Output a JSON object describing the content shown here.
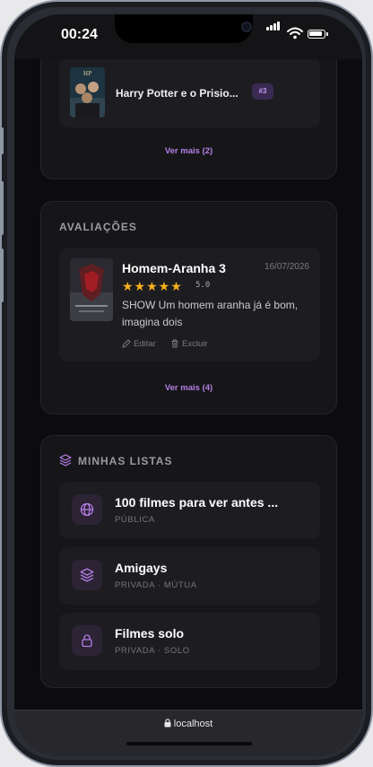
{
  "status": {
    "time": "00:24"
  },
  "top_list": {
    "item_title": "Harry Potter e o Prisio...",
    "rank_badge": "#3",
    "see_more": "Ver mais (2)"
  },
  "reviews": {
    "section_title": "AVALIAÇÕES",
    "items": [
      {
        "title": "Homem-Aranha 3",
        "date": "16/07/2026",
        "stars": "★★★★★",
        "score": "5.0",
        "text": "SHOW Um homem aranha já é bom, imagina dois",
        "edit_label": "Editar",
        "delete_label": "Excluir"
      }
    ],
    "see_more": "Ver mais (4)"
  },
  "lists": {
    "section_title": "MINHAS LISTAS",
    "items": [
      {
        "name": "100 filmes para ver antes ...",
        "meta": "PÚBLICA",
        "icon": "globe-icon"
      },
      {
        "name": "Amigays",
        "meta": "PRIVADA · MÚTUA",
        "icon": "layers-icon"
      },
      {
        "name": "Filmes solo",
        "meta": "PRIVADA · SOLO",
        "icon": "lock-icon"
      }
    ]
  },
  "browser": {
    "url": "localhost"
  },
  "colors": {
    "accent": "#b57ee6",
    "star": "#f7b11d",
    "background": "#0c0c0e"
  }
}
